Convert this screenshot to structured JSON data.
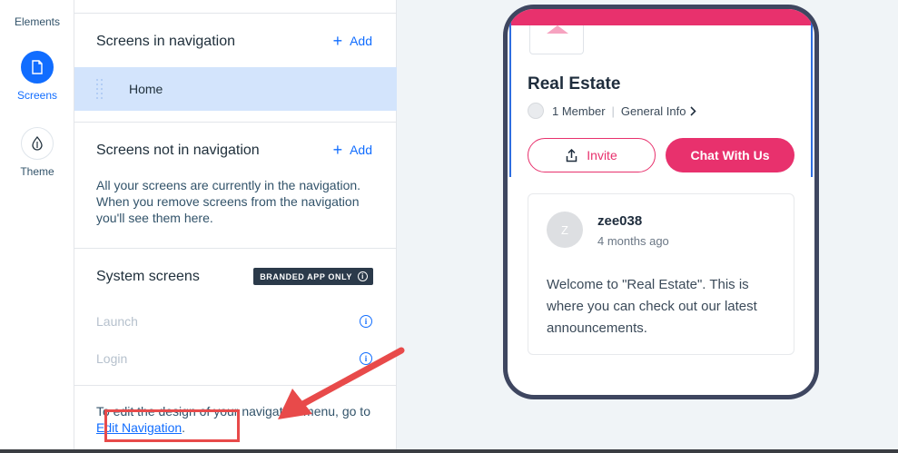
{
  "rail": {
    "elements_label": "Elements",
    "screens_label": "Screens",
    "theme_label": "Theme"
  },
  "panel": {
    "nav_title": "Screens in navigation",
    "add_label": "Add",
    "home_label": "Home",
    "not_nav_title": "Screens not in navigation",
    "not_nav_desc": "All your screens are currently in the navigation. When you remove screens from the navigation you'll see them here.",
    "system_title": "System screens",
    "branded_badge": "BRANDED APP ONLY",
    "system_items": [
      "Launch",
      "Login"
    ],
    "footnote_text": "To edit the design of your navigation menu, go to ",
    "footnote_link": "Edit Navigation",
    "footnote_end": "."
  },
  "phone": {
    "title": "Real Estate",
    "members": "1 Member",
    "general_info": "General Info",
    "invite_label": "Invite",
    "chat_label": "Chat With Us",
    "post": {
      "avatar_letter": "Z",
      "user": "zee038",
      "time": "4 months ago",
      "body": "Welcome to \"Real Estate\". This is where you can check out our latest announcements."
    }
  },
  "colors": {
    "accent_blue": "#116dff",
    "brand_pink": "#e8316d",
    "annotation_red": "#e84a4a"
  }
}
